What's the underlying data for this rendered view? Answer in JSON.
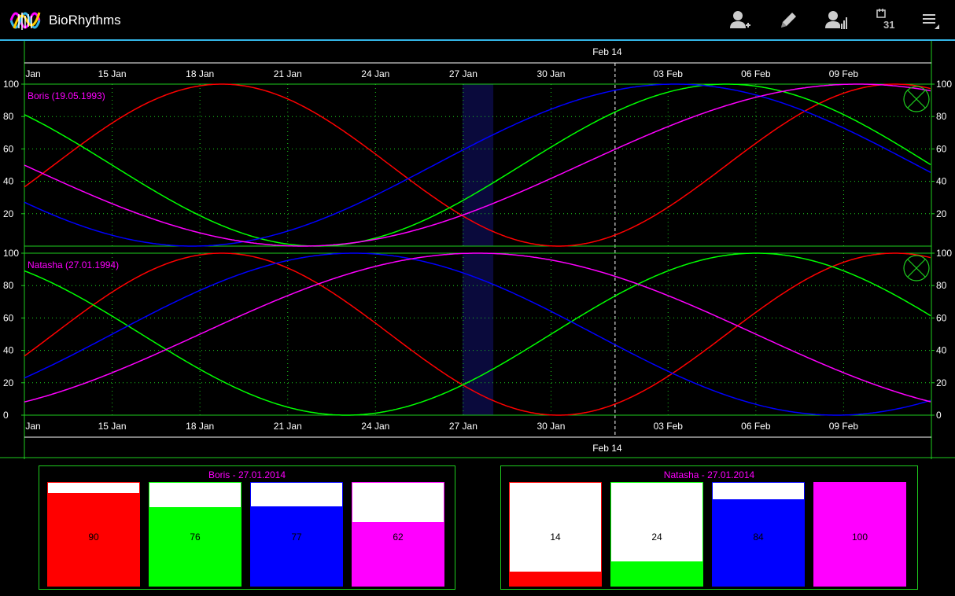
{
  "app": {
    "title": "BioRhythms"
  },
  "toolbar": {
    "icons": [
      "add-person-icon",
      "edit-pencil-icon",
      "person-stats-icon",
      "calendar-icon",
      "overflow-menu-icon"
    ],
    "calendar_day": "31"
  },
  "colors": {
    "physical": "#ff0000",
    "emotional": "#00ff00",
    "intellectual": "#0000ff",
    "intuitive": "#ff00ff",
    "grid": "#1ecc1e",
    "accent": "#33b5e5",
    "highlight": "#0a0a3c"
  },
  "chart": {
    "start_date": "2014-01-12",
    "end_date": "2014-02-12",
    "date_ticks": [
      "Jan",
      "15 Jan",
      "18 Jan",
      "21 Jan",
      "24 Jan",
      "27 Jan",
      "30 Jan",
      "03 Feb",
      "06 Feb",
      "09 Feb"
    ],
    "month_marker": "Feb 14",
    "selected_date": "27.01.2014",
    "y_ticks": [
      "100",
      "80",
      "60",
      "40",
      "20",
      "0"
    ]
  },
  "people": [
    {
      "name": "Boris",
      "birth": "19.05.1993",
      "label": "Boris (19.05.1993)"
    },
    {
      "name": "Natasha",
      "birth": "27.01.1994",
      "label": "Natasha (27.01.1994)"
    }
  ],
  "summary": [
    {
      "title": "Boris - 27.01.2014",
      "values": [
        90,
        76,
        77,
        62
      ],
      "labels": [
        "90",
        "76",
        "77",
        "62"
      ]
    },
    {
      "title": "Natasha - 27.01.2014",
      "values": [
        14,
        24,
        84,
        100
      ],
      "labels": [
        "14",
        "24",
        "84",
        "100"
      ]
    }
  ]
}
